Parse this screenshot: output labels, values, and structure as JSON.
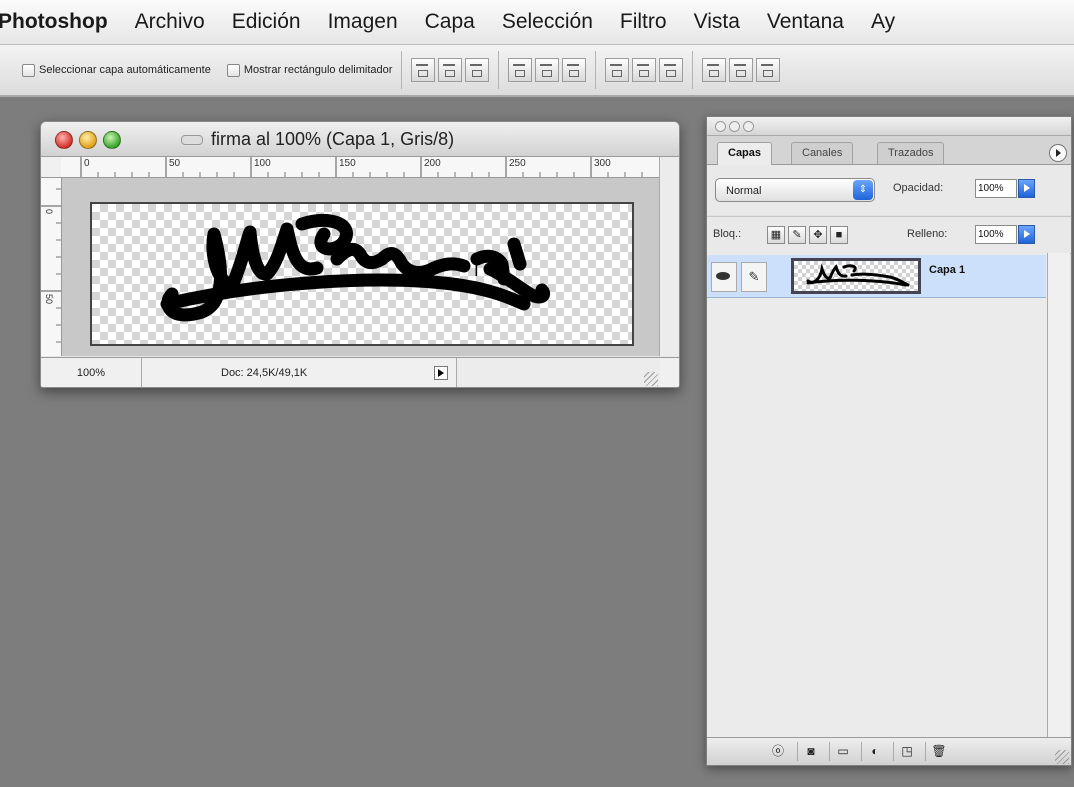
{
  "menubar": {
    "app": "Photoshop",
    "items": [
      "Archivo",
      "Edición",
      "Imagen",
      "Capa",
      "Selección",
      "Filtro",
      "Vista",
      "Ventana",
      "Ay"
    ]
  },
  "options": {
    "auto_select": "Seleccionar capa automáticamente",
    "show_bounds": "Mostrar rectángulo delimitador"
  },
  "document": {
    "title": "firma al 100% (Capa 1, Gris/8)",
    "ruler_h": [
      "0",
      "50",
      "100",
      "150",
      "200",
      "250",
      "300"
    ],
    "ruler_v": [
      "0",
      "50"
    ],
    "zoom": "100%",
    "doc_info": "Doc: 24,5K/49,1K"
  },
  "layers_panel": {
    "tabs": [
      "Capas",
      "Canales",
      "Trazados"
    ],
    "blend_mode": "Normal",
    "opacity_label": "Opacidad:",
    "opacity_value": "100%",
    "lock_label": "Bloq.:",
    "fill_label": "Relleno:",
    "fill_value": "100%",
    "layer_name": "Capa 1"
  }
}
